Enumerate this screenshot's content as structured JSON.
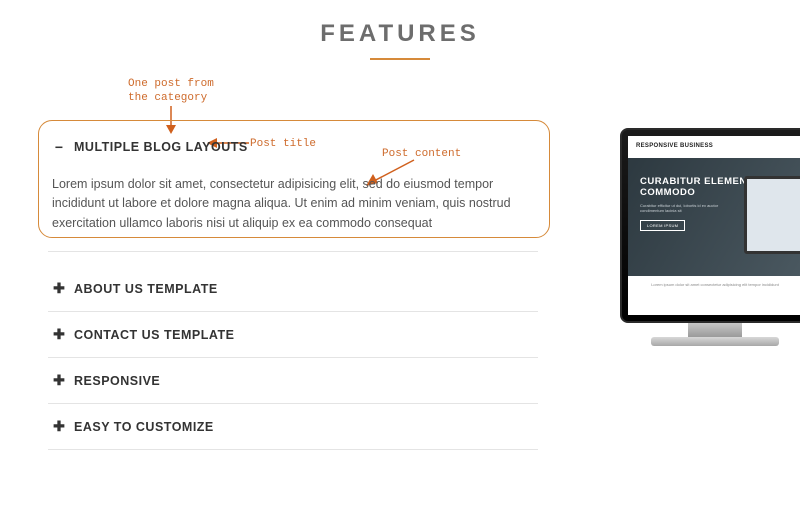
{
  "heading": {
    "title": "FEATURES"
  },
  "annotations": {
    "category_post": "One post from\nthe category",
    "post_title": "Post title",
    "post_content": "Post content"
  },
  "accordion": {
    "items": [
      {
        "icon": "−",
        "title": "MULTIPLE BLOG LAYOUTS",
        "expanded": true,
        "content": "Lorem ipsum dolor sit amet, consectetur adipisicing elit, sed do eiusmod tempor incididunt ut labore et dolore magna aliqua. Ut enim ad minim veniam, quis nostrud exercitation ullamco laboris nisi ut aliquip ex ea commodo consequat"
      },
      {
        "icon": "✚",
        "title": "ABOUT US TEMPLATE",
        "expanded": false
      },
      {
        "icon": "✚",
        "title": "CONTACT US TEMPLATE",
        "expanded": false
      },
      {
        "icon": "✚",
        "title": "RESPONSIVE",
        "expanded": false
      },
      {
        "icon": "✚",
        "title": "EASY TO CUSTOMIZE",
        "expanded": false
      }
    ]
  },
  "preview": {
    "brand": "RESPONSIVE BUSINESS",
    "hero_title": "CURABITUR ELEMENTUM IN COMMODO",
    "hero_sub": "Curabitur efficitur ut dui, lobortis id ex auctor condimentum lacinia sit",
    "hero_btn": "LOREM IPSUM",
    "bottom": "Lorem ipsum dolor sit amet consectetur adipisicing elit tempor incididunt"
  }
}
